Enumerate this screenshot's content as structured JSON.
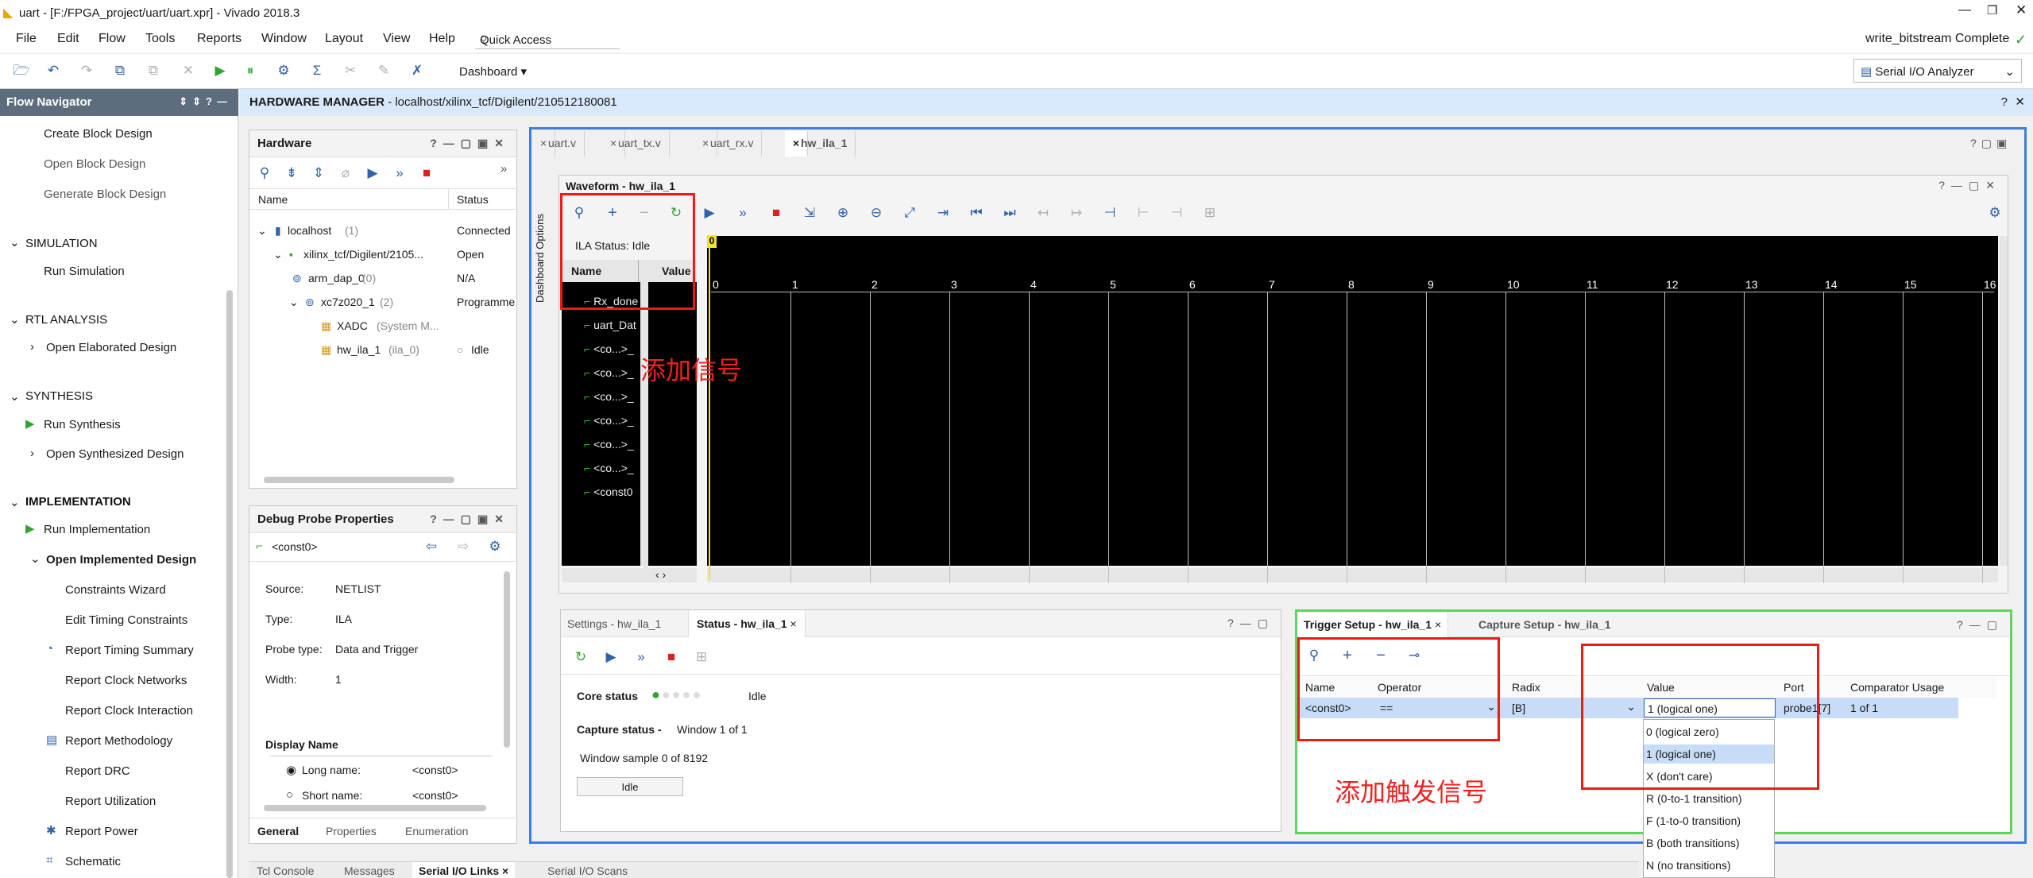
{
  "window": {
    "title": "uart - [F:/FPGA_project/uart/uart.xpr] - Vivado 2018.3",
    "status": "write_bitstream Complete",
    "quick_access": "Quick Access",
    "layout_select": "Serial I/O Analyzer",
    "dashboard": "Dashboard"
  },
  "menu": [
    "File",
    "Edit",
    "Flow",
    "Tools",
    "Reports",
    "Window",
    "Layout",
    "View",
    "Help"
  ],
  "nav": {
    "title": "Flow Navigator",
    "ip": [
      "Create Block Design",
      "Open Block Design",
      "Generate Block Design"
    ],
    "simulation": "SIMULATION",
    "run_sim": "Run Simulation",
    "rtl": "RTL ANALYSIS",
    "open_elab": "Open Elaborated Design",
    "synth": "SYNTHESIS",
    "run_synth": "Run Synthesis",
    "open_synth": "Open Synthesized Design",
    "impl": "IMPLEMENTATION",
    "run_impl": "Run Implementation",
    "open_impl": "Open Implemented Design",
    "impl_items": [
      "Constraints Wizard",
      "Edit Timing Constraints",
      "Report Timing Summary",
      "Report Clock Networks",
      "Report Clock Interaction",
      "Report Methodology",
      "Report DRC",
      "Report Utilization",
      "Report Power",
      "Schematic"
    ]
  },
  "hm": {
    "label": "HARDWARE MANAGER",
    "path": " - localhost/xilinx_tcf/Digilent/210512180081"
  },
  "hardware": {
    "title": "Hardware",
    "col_name": "Name",
    "col_status": "Status",
    "rows": [
      {
        "name": "localhost",
        "count": "(1)",
        "status": "Connected"
      },
      {
        "name": "xilinx_tcf/Digilent/2105...",
        "count": "",
        "status": "Open"
      },
      {
        "name": "arm_dap_0",
        "count": "(0)",
        "status": "N/A"
      },
      {
        "name": "xc7z020_1",
        "count": "(2)",
        "status": "Programme"
      },
      {
        "name": "XADC",
        "count": "(System M...",
        "status": ""
      },
      {
        "name": "hw_ila_1",
        "count": "(ila_0)",
        "status": "Idle"
      }
    ]
  },
  "probe": {
    "title": "Debug Probe Properties",
    "name": "<const0>",
    "source_l": "Source:",
    "source": "NETLIST",
    "type_l": "Type:",
    "type": "ILA",
    "ptype_l": "Probe type:",
    "ptype": "Data and Trigger",
    "width_l": "Width:",
    "width": "1",
    "display": "Display Name",
    "long_l": "Long name:",
    "long": "<const0>",
    "short_l": "Short name:",
    "short": "<const0>",
    "tabs": [
      "General",
      "Properties",
      "Enumeration"
    ]
  },
  "editor_tabs": [
    "uart.v",
    "uart_tx.v",
    "uart_rx.v",
    "hw_ila_1"
  ],
  "waveform": {
    "title": "Waveform - hw_ila_1",
    "ila_status": "ILA Status:  Idle",
    "col_name": "Name",
    "col_value": "Value",
    "side": "Dashboard Options",
    "signals": [
      "Rx_done",
      "uart_Dat",
      "<co...>_",
      "<co...>_",
      "<co...>_",
      "<co...>_",
      "<co...>_",
      "<co...>_",
      "<const0"
    ],
    "ticks": [
      "0",
      "1",
      "2",
      "3",
      "4",
      "5",
      "6",
      "7",
      "8",
      "9",
      "10",
      "11",
      "12",
      "13",
      "14",
      "15",
      "16"
    ],
    "cursor": "0"
  },
  "annot": {
    "add_signal": "添加信号",
    "add_trigger": "添加触发信号"
  },
  "status_panel": {
    "tabs": [
      "Settings - hw_ila_1",
      "Status - hw_ila_1"
    ],
    "core_l": "Core status",
    "core": "Idle",
    "cap_l": "Capture status -",
    "cap": "Window 1 of 1",
    "sample": "Window sample 0 of 8192",
    "btn": "Idle"
  },
  "trigger": {
    "tabs": [
      "Trigger Setup - hw_ila_1",
      "Capture Setup - hw_ila_1"
    ],
    "cols": [
      "Name",
      "Operator",
      "Radix",
      "Value",
      "Port",
      "Comparator Usage"
    ],
    "row": {
      "name": "<const0>",
      "op": "==",
      "radix": "[B]",
      "value": "1 (logical one)",
      "port": "probe1[7]",
      "usage": "1 of 1"
    },
    "options": [
      "0 (logical zero)",
      "1 (logical one)",
      "X (don't care)",
      "R (0-to-1 transition)",
      "F (1-to-0 transition)",
      "B (both transitions)",
      "N (no transitions)"
    ]
  },
  "bottom_tabs": [
    "Tcl Console",
    "Messages",
    "Serial I/O Links",
    "Serial I/O Scans"
  ]
}
